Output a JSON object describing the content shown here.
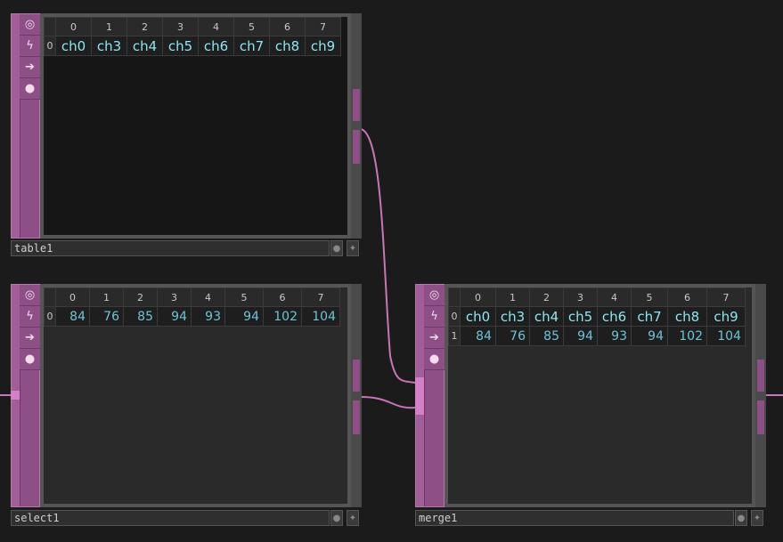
{
  "nodes": {
    "table1": {
      "name": "table1",
      "columns": [
        "0",
        "1",
        "2",
        "3",
        "4",
        "5",
        "6",
        "7"
      ],
      "rows": [
        {
          "index": "0",
          "cells": [
            "ch0",
            "ch3",
            "ch4",
            "ch5",
            "ch6",
            "ch7",
            "ch8",
            "ch9"
          ]
        }
      ]
    },
    "select1": {
      "name": "select1",
      "columns": [
        "0",
        "1",
        "2",
        "3",
        "4",
        "5",
        "6",
        "7"
      ],
      "rows": [
        {
          "index": "0",
          "cells": [
            "84",
            "76",
            "85",
            "94",
            "93",
            "94",
            "102",
            "104"
          ]
        }
      ]
    },
    "merge1": {
      "name": "merge1",
      "columns": [
        "0",
        "1",
        "2",
        "3",
        "4",
        "5",
        "6",
        "7"
      ],
      "rows": [
        {
          "index": "0",
          "cells": [
            "ch0",
            "ch3",
            "ch4",
            "ch5",
            "ch6",
            "ch7",
            "ch8",
            "ch9"
          ]
        },
        {
          "index": "1",
          "cells": [
            "84",
            "76",
            "85",
            "94",
            "93",
            "94",
            "102",
            "104"
          ]
        }
      ]
    }
  },
  "side_icons": [
    "viewer-icon",
    "bypass-icon",
    "display-icon",
    "lock-icon"
  ],
  "colors": {
    "accent": "#8e4f86",
    "wire": "#c874b8",
    "cell_text": "#8ce6f0"
  }
}
